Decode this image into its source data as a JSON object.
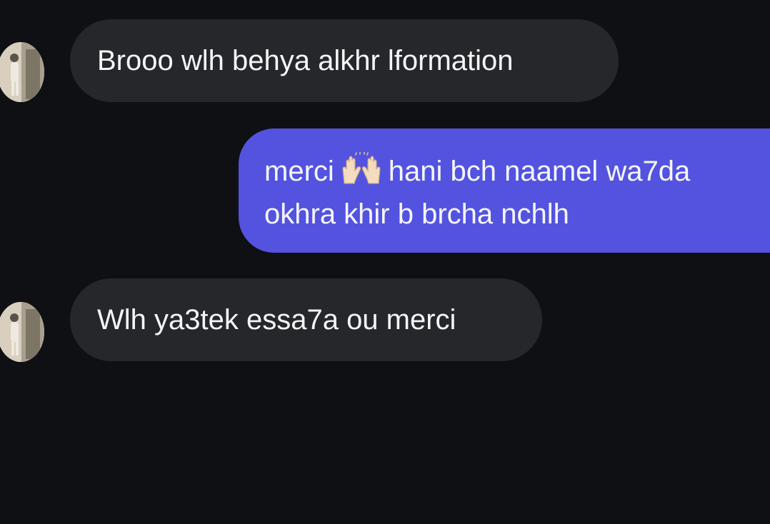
{
  "messages": [
    {
      "direction": "incoming",
      "text": "Brooo wlh behya alkhr lformation"
    },
    {
      "direction": "outgoing",
      "line1_before": "merci",
      "emoji": "raised-hands",
      "line1_after": "hani bch naamel wa7da",
      "line2": "okhra khir b brcha nchlh"
    },
    {
      "direction": "incoming",
      "text": "Wlh ya3tek essa7a ou merci"
    }
  ],
  "colors": {
    "background": "#0f1013",
    "incoming_bubble": "#26272b",
    "outgoing_bubble": "#5353e0",
    "text": "#f5f5f7"
  }
}
